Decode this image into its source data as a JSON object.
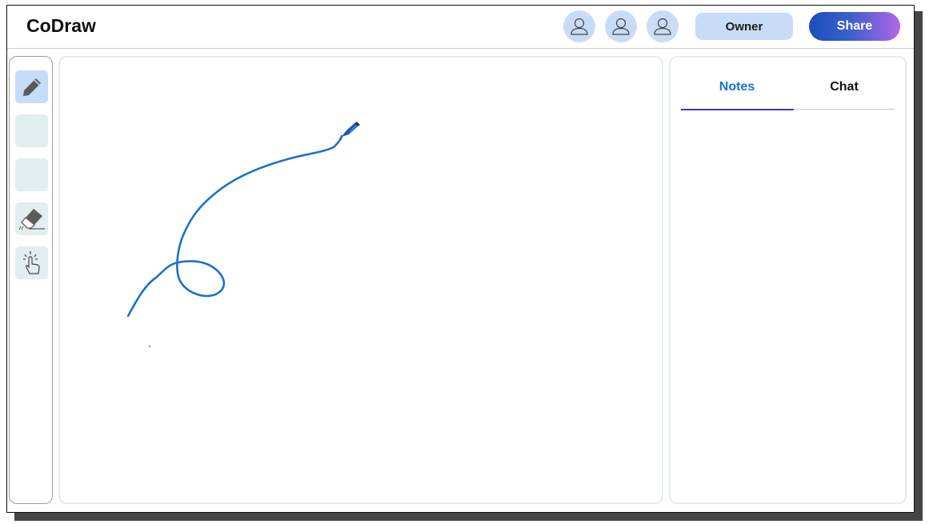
{
  "app": {
    "title": "CoDraw"
  },
  "header": {
    "avatars": [
      {
        "icon": "user-icon"
      },
      {
        "icon": "user-icon"
      },
      {
        "icon": "user-icon"
      }
    ],
    "owner_label": "Owner",
    "share_label": "Share"
  },
  "toolbar": {
    "tools": [
      {
        "name": "pencil",
        "icon": "pencil-icon",
        "active": true
      },
      {
        "name": "empty-1",
        "icon": "",
        "active": false
      },
      {
        "name": "empty-2",
        "icon": "",
        "active": false
      },
      {
        "name": "eraser",
        "icon": "eraser-icon",
        "active": false
      },
      {
        "name": "pointer",
        "icon": "pointer-icon",
        "active": false
      }
    ]
  },
  "canvas": {
    "stroke_color": "#1a73c8"
  },
  "panel": {
    "tabs": [
      {
        "label": "Notes",
        "active": true
      },
      {
        "label": "Chat",
        "active": false
      }
    ]
  },
  "colors": {
    "accent": "#1b72d0",
    "tab_indicator": "#4535c4",
    "avatar_bg": "#c9dcf7",
    "tool_bg": "#e2eeef",
    "tool_active_bg": "#c7dcf8"
  }
}
